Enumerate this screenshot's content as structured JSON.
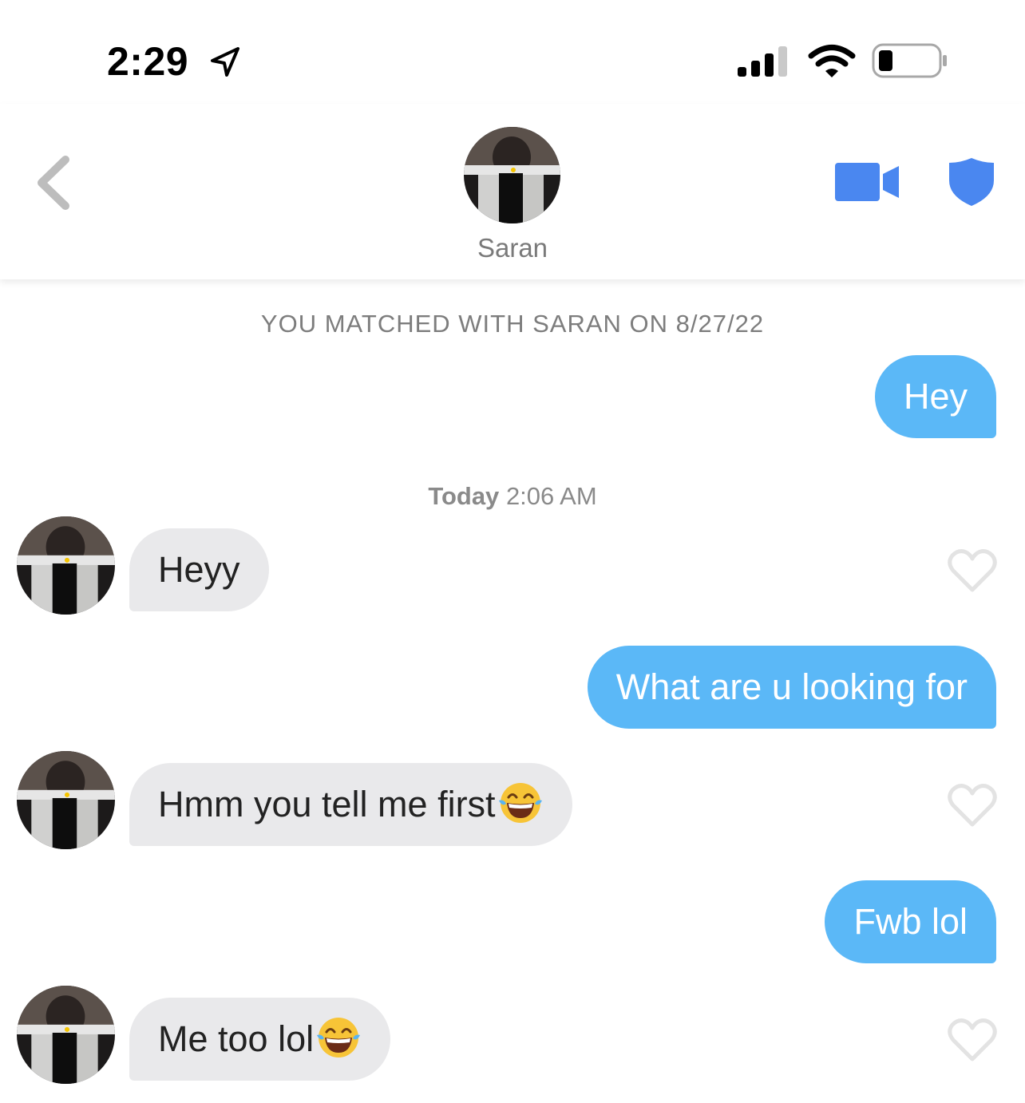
{
  "status_bar": {
    "time": "2:29",
    "icons": [
      "location-arrow-icon",
      "cellular-signal-icon",
      "wifi-icon",
      "battery-icon"
    ]
  },
  "header": {
    "back_icon": "chevron-left-icon",
    "contact_name": "Saran",
    "video_icon": "video-camera-icon",
    "safety_icon": "shield-icon",
    "accent_color": "#4a87f0"
  },
  "chat": {
    "match_notice": "YOU MATCHED WITH SARAN ON 8/27/22",
    "timestamp_day": "Today",
    "timestamp_time": "2:06 AM",
    "messages": [
      {
        "from": "me",
        "text": "Hey"
      },
      {
        "from": "them",
        "text": "Heyy"
      },
      {
        "from": "me",
        "text": "What are u looking for"
      },
      {
        "from": "them",
        "text": "Hmm you tell me first",
        "emoji": "face-with-tears-of-joy"
      },
      {
        "from": "me",
        "text": "Fwb lol"
      },
      {
        "from": "them",
        "text": "Me too lol",
        "emoji": "face-with-tears-of-joy"
      }
    ],
    "outgoing_color": "#5bb8f7",
    "incoming_color": "#e9e9eb"
  }
}
